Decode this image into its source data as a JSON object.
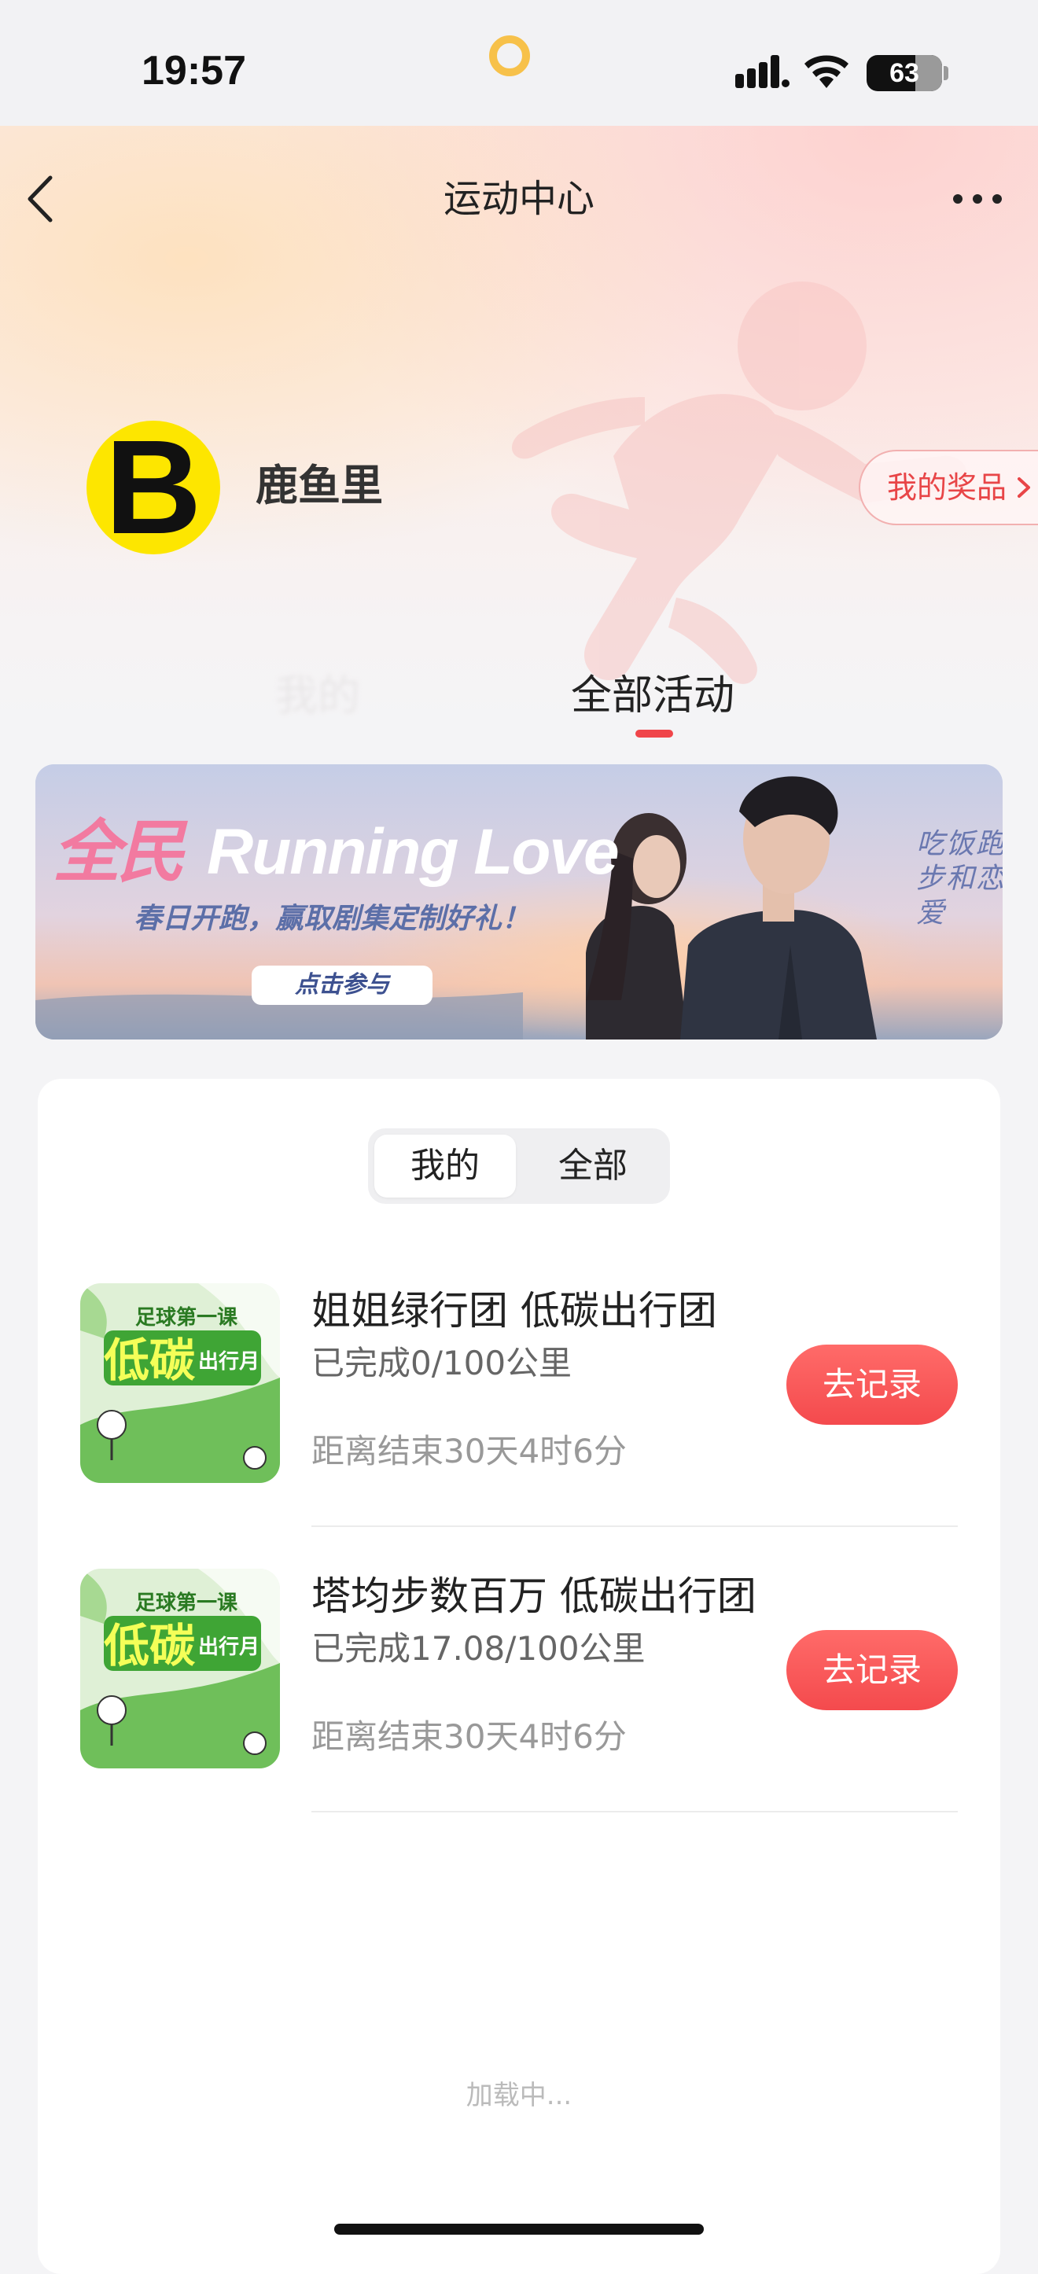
{
  "status_bar": {
    "time": "19:57",
    "battery": "63"
  },
  "nav": {
    "title": "运动中心"
  },
  "profile": {
    "avatar_letter": "B",
    "username": "鹿鱼里",
    "prizes_label": "我的奖品"
  },
  "tabs": {
    "inactive_label": "我的",
    "active_label": "全部活动"
  },
  "banner": {
    "title_cn": "全民",
    "title_en": "Running Love",
    "subtitle": "春日开跑，赢取剧集定制好礼！",
    "cta": "点击参与",
    "side_text": "吃饭跑步和恋爱"
  },
  "segment": {
    "mine": "我的",
    "all": "全部"
  },
  "activities": [
    {
      "title": "姐姐绿行团 低碳出行团",
      "progress": "已完成0/100公里",
      "countdown": "距离结束30天4时6分",
      "button": "去记录",
      "thumb": {
        "line1": "足球第一课",
        "big": "低碳",
        "line2": "出行月"
      }
    },
    {
      "title": "塔均步数百万 低碳出行团",
      "progress": "已完成17.08/100公里",
      "countdown": "距离结束30天4时6分",
      "button": "去记录",
      "thumb": {
        "line1": "足球第一课",
        "big": "低碳",
        "line2": "出行月"
      }
    }
  ],
  "loading": "加载中...",
  "colors": {
    "accent": "#f0454a",
    "button": "#f44a4d",
    "avatar_bg": "#fde600"
  },
  "icons": {
    "back": "chevron-left-icon",
    "more": "more-dots-icon",
    "prizes_chevron": "chevron-right-icon"
  }
}
